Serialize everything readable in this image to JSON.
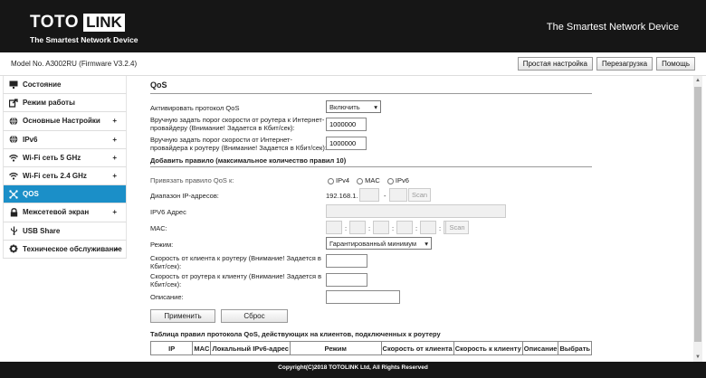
{
  "header": {
    "brand_left": "TOTO",
    "brand_right": "LINK",
    "tagline": "The Smartest Network Device",
    "slogan": "The Smartest Network Device"
  },
  "topbar": {
    "model": "Model No. A3002RU (Firmware V3.2.4)",
    "buttons": [
      "Простая настройка",
      "Перезагрузка",
      "Помощь"
    ]
  },
  "sidebar": {
    "items": [
      {
        "label": "Состояние",
        "icon": "monitor-icon",
        "plus": ""
      },
      {
        "label": "Режим работы",
        "icon": "export-icon",
        "plus": ""
      },
      {
        "label": "Основные Настройки",
        "icon": "globe-icon",
        "plus": "+"
      },
      {
        "label": "IPv6",
        "icon": "globe-icon",
        "plus": "+"
      },
      {
        "label": "Wi-Fi сеть 5 GHz",
        "icon": "wifi-icon",
        "plus": "+"
      },
      {
        "label": "Wi-Fi сеть 2.4 GHz",
        "icon": "wifi-icon",
        "plus": "+"
      },
      {
        "label": "QOS",
        "icon": "network-icon",
        "plus": ""
      },
      {
        "label": "Межсетевой экран",
        "icon": "lock-icon",
        "plus": "+"
      },
      {
        "label": "USB Share",
        "icon": "usb-icon",
        "plus": ""
      },
      {
        "label": "Техническое обслуживание",
        "icon": "gear-icon",
        "plus": "+"
      }
    ]
  },
  "main": {
    "title": "QoS",
    "enable_label": "Активировать протокол QoS",
    "enable_value": "Включить",
    "up_label_1": "Вручную задать порог скорости от роутера к Интернет-",
    "up_label_2": "провайдеру (Внимание! Задается в Кбит/сек):",
    "up_value": "1000000",
    "down_label_1": "Вручную задать порог скорости от Интернет-",
    "down_label_2": "провайдера к роутеру (Внимание! Задается в Кбит/сек):",
    "down_value": "1000000",
    "add_rule": "Добавить правило (максимальное количество правил 10)",
    "bind_label": "Привязать правило QoS к:",
    "bind_ipv4": "IPv4",
    "bind_mac": "MAC",
    "bind_ipv6": "IPv6",
    "ip_range_label": "Диапазон IP-адресов:",
    "ip_prefix": "192.168.1.",
    "dash": "-",
    "scan": "Scan",
    "ipv6_label": "IPV6 Адрес",
    "mac_label": "MAC:",
    "mac_sep": ":",
    "mode_label": "Режим:",
    "mode_value": "Гарантированный минимум",
    "c2r_label_1": "Скорость от клиента к роутеру (Внимание! Задается в",
    "c2r_label_2": "Кбит/сек):",
    "r2c_label_1": "Скорость от роутера к клиенту (Внимание! Задается в",
    "r2c_label_2": "Кбит/сек):",
    "desc_label": "Описание:",
    "apply": "Применить",
    "reset": "Сброс",
    "table_title": "Таблица правил протокола QoS, действующих на клиентов, подключенных к роутеру",
    "columns": [
      "IP",
      "MAC",
      "Локальный IPv6-адрес",
      "Режим",
      "Скорость от клиента",
      "Скорость к клиенту",
      "Описание",
      "Выбрать"
    ]
  },
  "footer": {
    "text": "Copyright(C)2018 TOTOLINK Ltd, All Rights Reserved"
  }
}
